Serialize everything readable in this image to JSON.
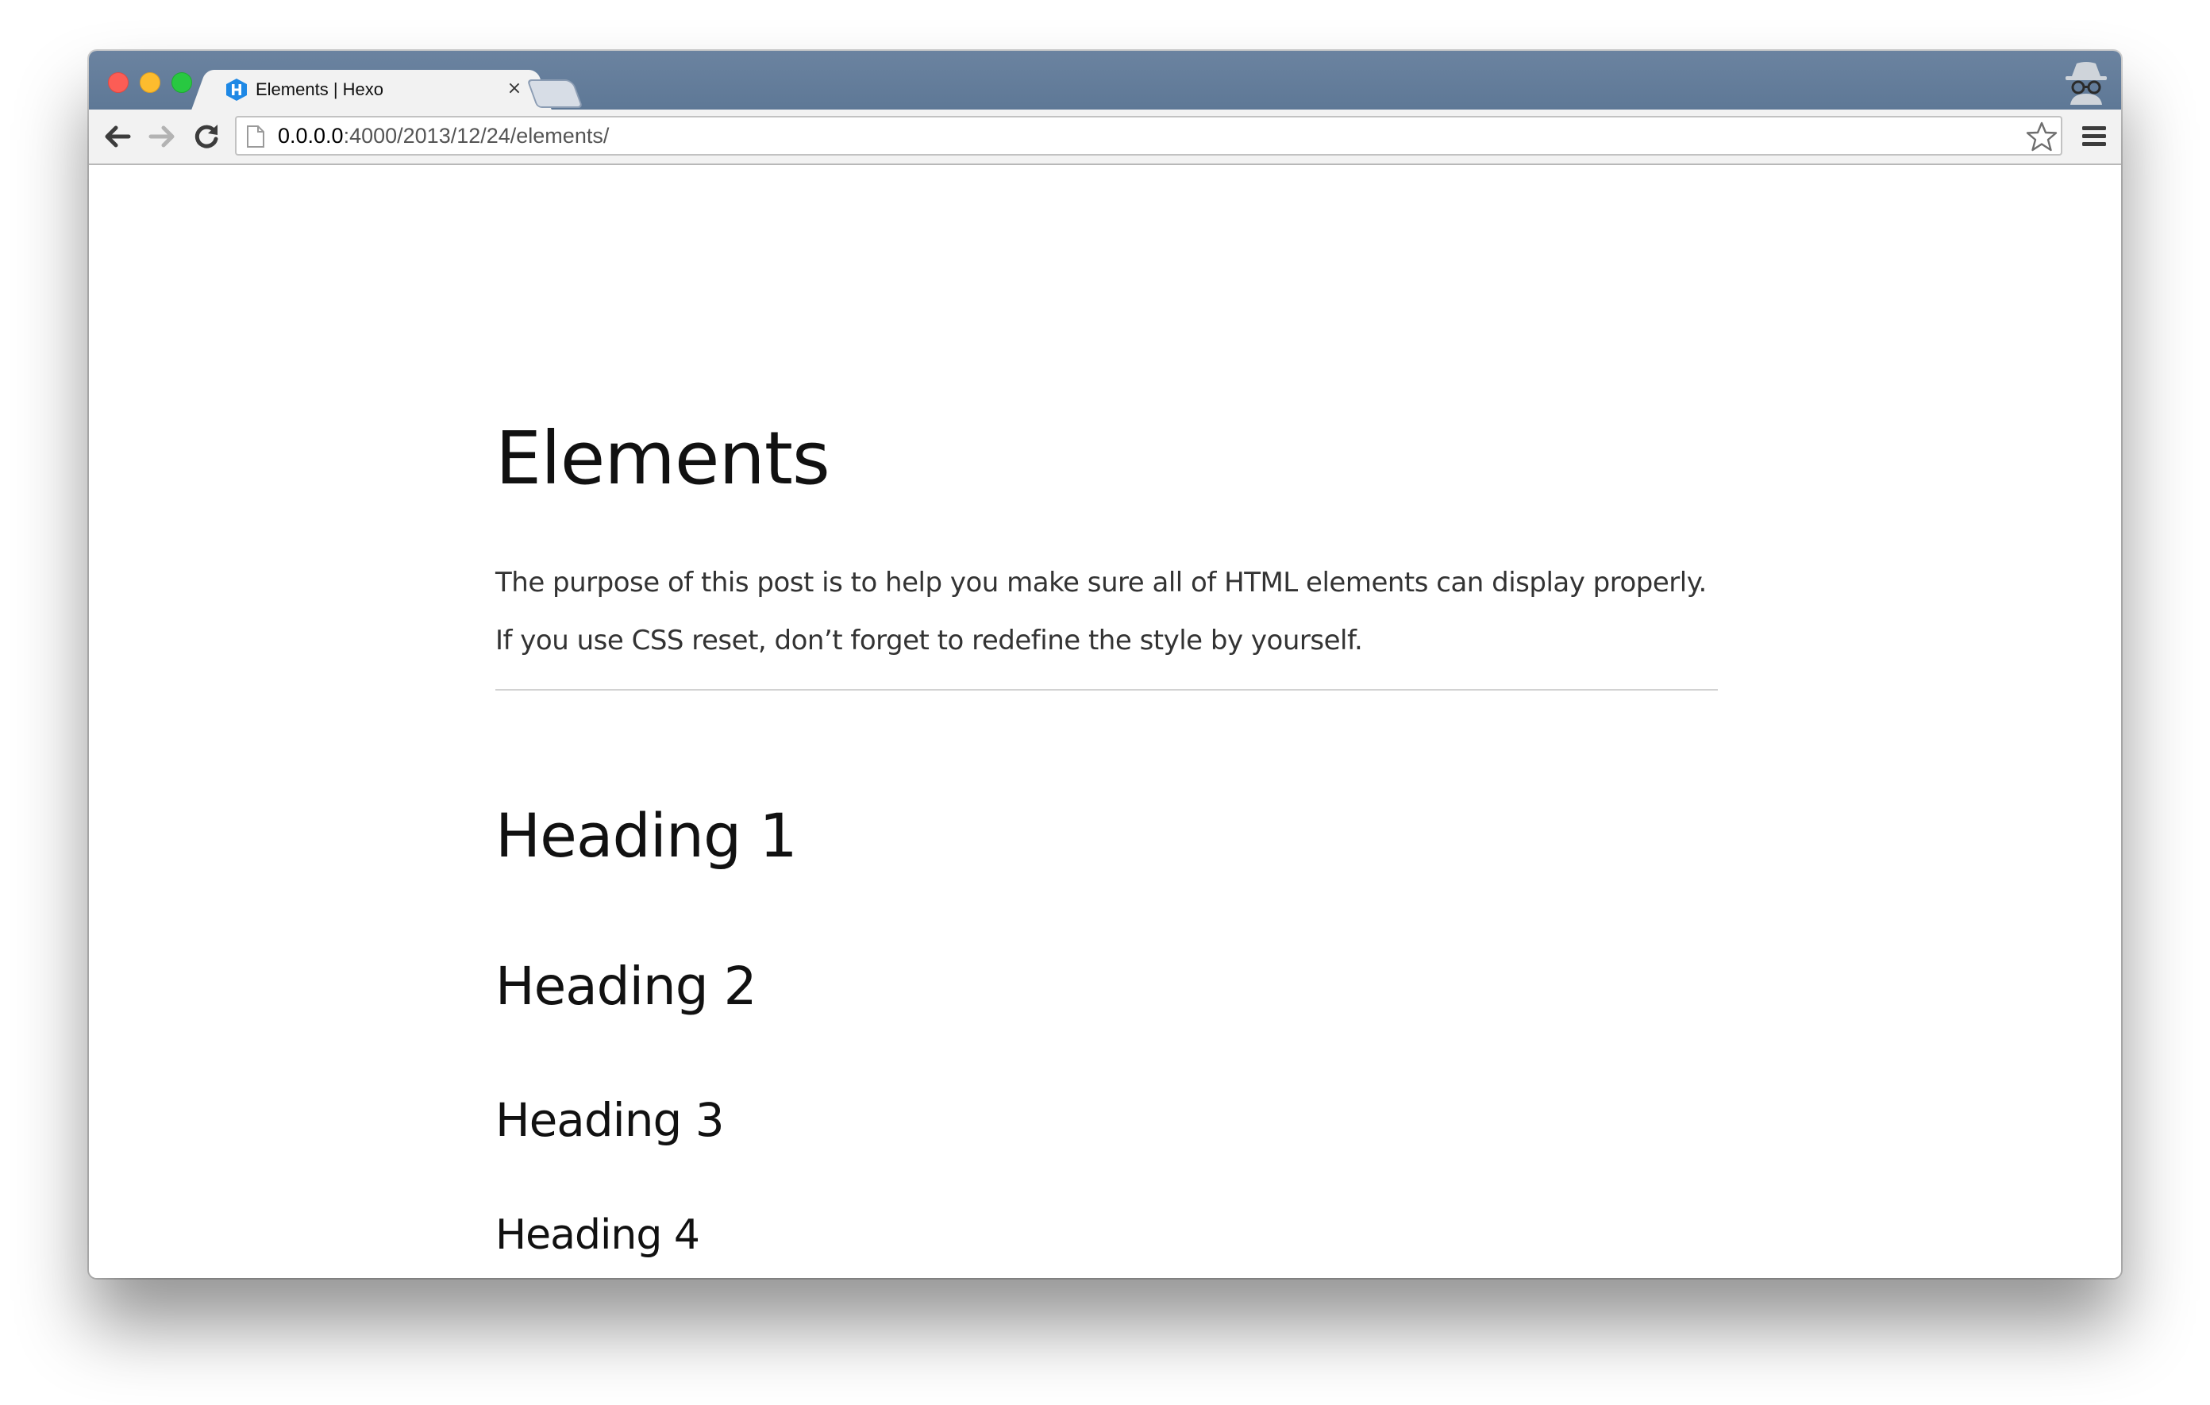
{
  "browser": {
    "tab": {
      "title": "Elements | Hexo",
      "favicon_icon": "hexo-logo-icon",
      "close_label": "×"
    },
    "toolbar": {
      "back_icon": "back-arrow-icon",
      "forward_icon": "forward-arrow-icon",
      "reload_icon": "reload-icon",
      "url_host": "0.0.0.0",
      "url_path": ":4000/2013/12/24/elements/",
      "bookmark_icon": "star-icon",
      "menu_icon": "hamburger-menu-icon"
    },
    "incognito_icon": "incognito-icon"
  },
  "page": {
    "title": "Elements",
    "intro_line_1": "The purpose of this post is to help you make sure all of HTML elements can display properly.",
    "intro_line_2": "If you use CSS reset, don’t forget to redefine the style by yourself.",
    "headings": [
      "Heading 1",
      "Heading 2",
      "Heading 3",
      "Heading 4"
    ]
  },
  "colors": {
    "titlebar": "#5e7896",
    "favicon": "#1e88e5",
    "text": "#111111"
  }
}
